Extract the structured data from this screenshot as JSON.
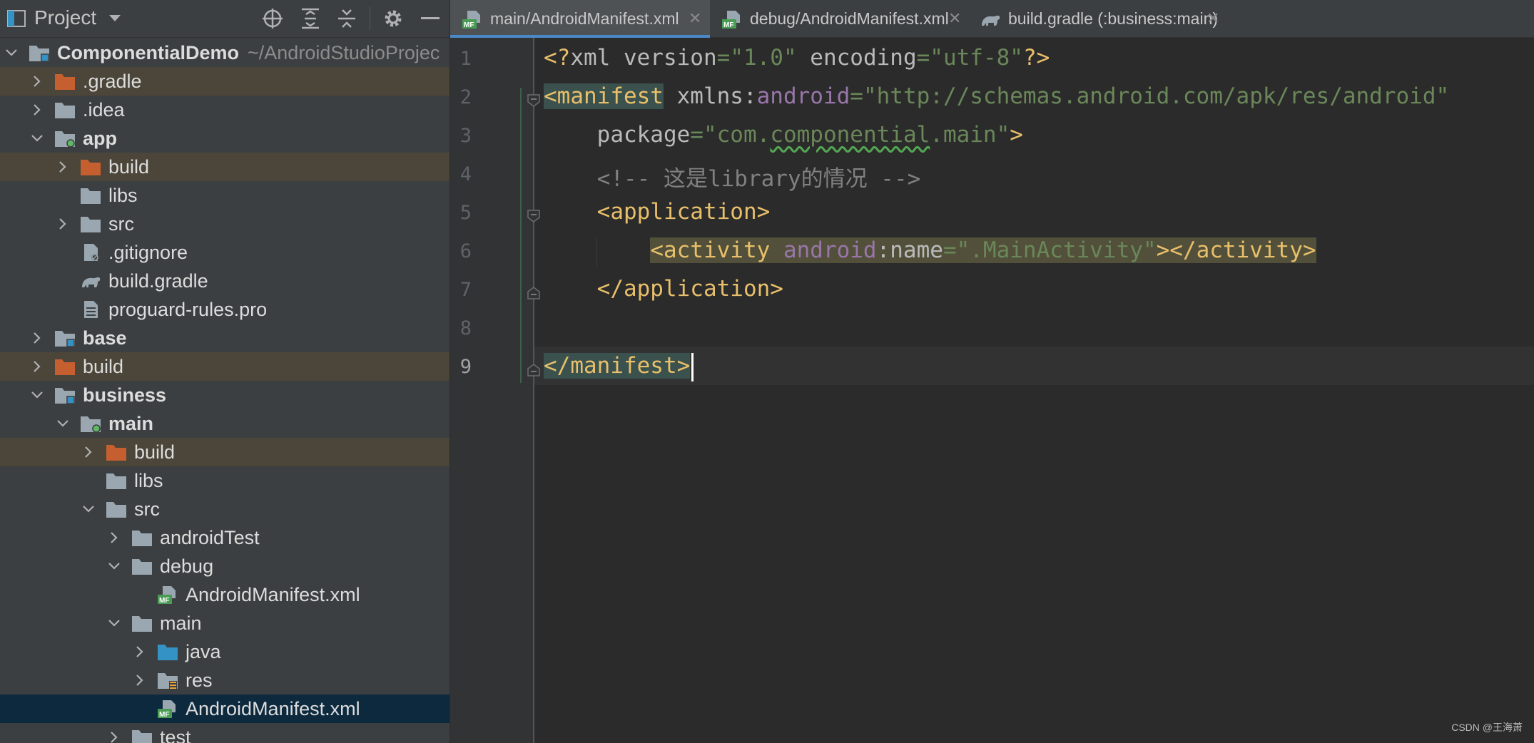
{
  "project_panel": {
    "title": "Project",
    "toolbar_icons": [
      "locate-icon",
      "expand-all-icon",
      "collapse-all-icon",
      "settings-icon",
      "minimize-icon"
    ],
    "tree": [
      {
        "label": "ComponentialDemo",
        "suffix": "~/AndroidStudioProjec",
        "depth": 0,
        "icon": "module-folder-icon",
        "expanded": true,
        "bold": true
      },
      {
        "label": ".gradle",
        "depth": 1,
        "icon": "excluded-folder-icon",
        "expanded": false,
        "excluded": true
      },
      {
        "label": ".idea",
        "depth": 1,
        "icon": "folder-icon",
        "expanded": false
      },
      {
        "label": "app",
        "depth": 1,
        "icon": "app-module-icon",
        "expanded": true,
        "bold": true
      },
      {
        "label": "build",
        "depth": 2,
        "icon": "excluded-folder-icon",
        "expanded": false,
        "excluded": true
      },
      {
        "label": "libs",
        "depth": 2,
        "icon": "folder-icon"
      },
      {
        "label": "src",
        "depth": 2,
        "icon": "folder-icon",
        "expanded": false
      },
      {
        "label": ".gitignore",
        "depth": 2,
        "icon": "gitignore-file-icon"
      },
      {
        "label": "build.gradle",
        "depth": 2,
        "icon": "gradle-file-icon"
      },
      {
        "label": "proguard-rules.pro",
        "depth": 2,
        "icon": "text-file-icon"
      },
      {
        "label": "base",
        "depth": 1,
        "icon": "module-folder-icon",
        "expanded": false,
        "bold": true
      },
      {
        "label": "build",
        "depth": 1,
        "icon": "excluded-folder-icon",
        "expanded": false,
        "excluded": true
      },
      {
        "label": "business",
        "depth": 1,
        "icon": "module-folder-icon",
        "expanded": true,
        "bold": true
      },
      {
        "label": "main",
        "depth": 2,
        "icon": "app-module-icon",
        "expanded": true,
        "bold": true
      },
      {
        "label": "build",
        "depth": 3,
        "icon": "excluded-folder-icon",
        "expanded": false,
        "excluded": true
      },
      {
        "label": "libs",
        "depth": 3,
        "icon": "folder-icon"
      },
      {
        "label": "src",
        "depth": 3,
        "icon": "folder-icon",
        "expanded": true
      },
      {
        "label": "androidTest",
        "depth": 4,
        "icon": "folder-icon",
        "expanded": false
      },
      {
        "label": "debug",
        "depth": 4,
        "icon": "folder-icon",
        "expanded": true
      },
      {
        "label": "AndroidManifest.xml",
        "depth": 5,
        "icon": "manifest-file-icon"
      },
      {
        "label": "main",
        "depth": 4,
        "icon": "folder-icon",
        "expanded": true
      },
      {
        "label": "java",
        "depth": 5,
        "icon": "source-folder-icon",
        "expanded": false
      },
      {
        "label": "res",
        "depth": 5,
        "icon": "resource-folder-icon",
        "expanded": false
      },
      {
        "label": "AndroidManifest.xml",
        "depth": 5,
        "icon": "manifest-file-icon",
        "selected": true
      },
      {
        "label": "test",
        "depth": 4,
        "icon": "folder-icon",
        "expanded": false
      }
    ]
  },
  "tabs": [
    {
      "label": "main/AndroidManifest.xml",
      "icon": "manifest-file-icon",
      "active": true,
      "close": "✕"
    },
    {
      "label": "debug/AndroidManifest.xml",
      "icon": "manifest-file-icon",
      "active": false,
      "close": "✕"
    },
    {
      "label": "build.gradle (:business:main)",
      "icon": "gradle-file-icon",
      "active": false,
      "close": "✕"
    }
  ],
  "editor": {
    "current_line": 9,
    "lines": [
      {
        "no": "1",
        "tokens": [
          [
            "<?",
            "k-tag"
          ],
          [
            "xml ",
            "k-attr"
          ],
          [
            "version",
            "k-attr"
          ],
          [
            "=",
            "k-val"
          ],
          [
            "\"1.0\"",
            "k-val"
          ],
          [
            " encoding",
            "k-attr"
          ],
          [
            "=",
            "k-val"
          ],
          [
            "\"utf-8\"",
            "k-val"
          ],
          [
            "?>",
            "k-tag"
          ]
        ]
      },
      {
        "no": "2",
        "tokens": [
          [
            "<manifest",
            "k-tag hl-tag"
          ],
          [
            " xmlns:",
            "k-attr"
          ],
          [
            "android",
            "k-ns"
          ],
          [
            "=",
            "k-val"
          ],
          [
            "\"http://schemas.android.com/apk/res/android\"",
            "k-val"
          ]
        ]
      },
      {
        "no": "3",
        "tokens": [
          [
            "    package",
            "k-attr"
          ],
          [
            "=",
            "k-val"
          ],
          [
            "\"com.",
            "k-val"
          ],
          [
            "componential",
            "k-val squiggle"
          ],
          [
            ".main\"",
            "k-val"
          ],
          [
            ">",
            "k-tag"
          ]
        ]
      },
      {
        "no": "4",
        "tokens": [
          [
            "    <!-- 这是library的情况 -->",
            "k-com"
          ]
        ]
      },
      {
        "no": "5",
        "tokens": [
          [
            "    ",
            "k-txt"
          ],
          [
            "<application>",
            "k-tag"
          ]
        ]
      },
      {
        "no": "6",
        "tokens": [
          [
            "        ",
            "k-txt"
          ],
          [
            "<activity ",
            "k-tag hl-activity"
          ],
          [
            "android",
            "k-ns hl-activity"
          ],
          [
            ":name",
            "k-attr hl-activity"
          ],
          [
            "=",
            "k-val hl-activity"
          ],
          [
            "\".MainActivity\"",
            "k-val hl-activity"
          ],
          [
            "></activity>",
            "k-tag hl-activity"
          ]
        ]
      },
      {
        "no": "7",
        "tokens": [
          [
            "    ",
            "k-txt"
          ],
          [
            "</application>",
            "k-tag"
          ]
        ]
      },
      {
        "no": "8",
        "tokens": []
      },
      {
        "no": "9",
        "tokens": [
          [
            "</manifest>",
            "k-tag hl-tag"
          ]
        ]
      }
    ]
  },
  "watermark": "CSDN @王海萧"
}
